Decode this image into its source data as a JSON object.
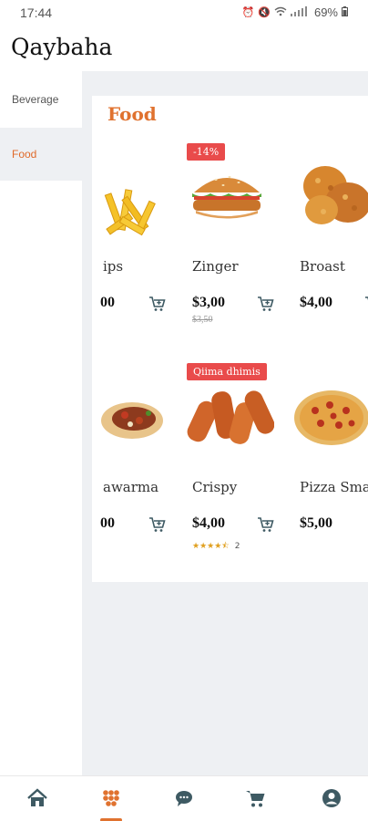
{
  "status_bar": {
    "time": "17:44",
    "battery": "69%"
  },
  "header": {
    "title": "Qaybaha"
  },
  "sidebar": {
    "items": [
      {
        "label": "Beverage",
        "active": false
      },
      {
        "label": "Food",
        "active": true
      }
    ]
  },
  "section": {
    "title": "Food"
  },
  "products": [
    {
      "name": "ips",
      "price": "00",
      "badge": "",
      "image": "fries-image"
    },
    {
      "name": "Zinger",
      "price": "$3,00",
      "old_price": "$3,50",
      "badge": "-14%",
      "image": "burger-image"
    },
    {
      "name": "Broast",
      "price": "$4,00",
      "badge": "",
      "image": "fried-chicken-image"
    },
    {
      "name": "awarma",
      "price": "00",
      "badge": "",
      "image": "shawarma-image"
    },
    {
      "name": "Crispy",
      "price": "$4,00",
      "badge": "Qiima dhimis",
      "rating_stars": 4.5,
      "rating_count": "2",
      "image": "crispy-strips-image"
    },
    {
      "name": "Pizza Small",
      "price": "$5,00",
      "badge": "",
      "image": "pizza-image"
    }
  ],
  "bottom_nav": {
    "items": [
      "home-icon",
      "categories-icon",
      "chat-icon",
      "cart-icon",
      "profile-icon"
    ],
    "active_index": 1
  },
  "colors": {
    "accent": "#e0722f",
    "badge": "#e94b4b",
    "background": "#eef0f3"
  }
}
